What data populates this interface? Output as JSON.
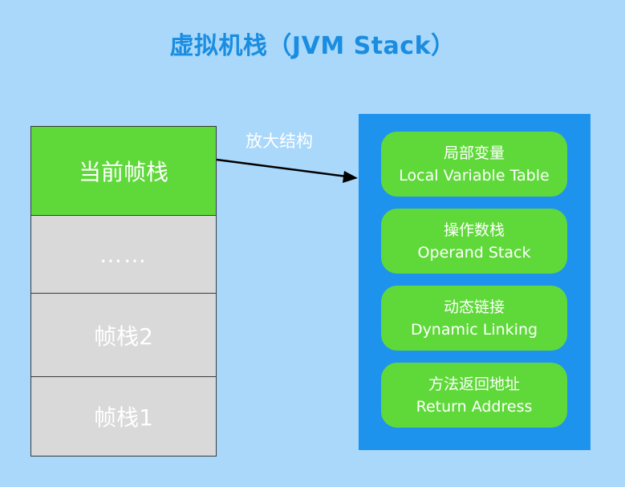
{
  "title": "虚拟机栈（JVM Stack）",
  "stack": {
    "frames": [
      {
        "label": "当前帧栈",
        "color": "#5fd93a"
      },
      {
        "label": "……",
        "color": "#d9d9d9"
      },
      {
        "label": "帧栈2",
        "color": "#d9d9d9"
      },
      {
        "label": "帧栈1",
        "color": "#d9d9d9"
      }
    ]
  },
  "arrow_label": "放大结构",
  "frame_structure": {
    "items": [
      {
        "zh": "局部变量",
        "en": "Local Variable Table"
      },
      {
        "zh": "操作数栈",
        "en": "Operand Stack"
      },
      {
        "zh": "动态链接",
        "en": "Dynamic Linking"
      },
      {
        "zh": "方法返回地址",
        "en": "Return Address"
      }
    ]
  },
  "colors": {
    "background": "#a9d8fb",
    "title": "#1a8de0",
    "panel": "#1e93ee",
    "current_frame": "#5fd93a",
    "frame": "#d9d9d9",
    "item": "#5fd93a"
  }
}
